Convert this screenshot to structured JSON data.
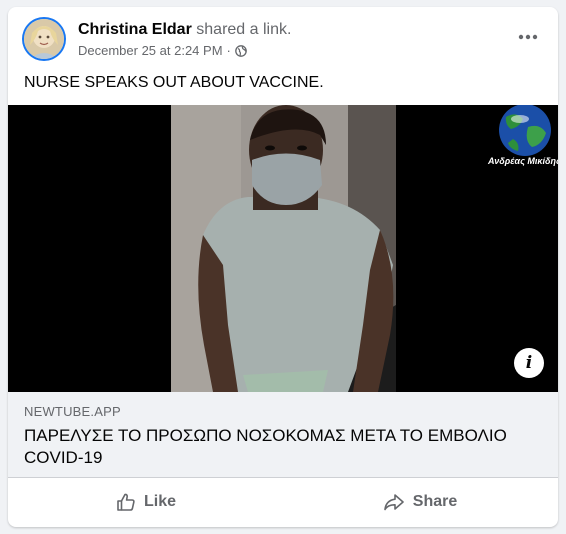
{
  "post": {
    "author": "Christina Eldar",
    "action_text": "shared a link.",
    "timestamp": "December 25 at 2:24 PM",
    "separator": "·",
    "privacy_icon": "globe-icon",
    "text": "NURSE SPEAKS OUT ABOUT VACCINE."
  },
  "media": {
    "watermark_text": "Ανδρέας Μικίδης"
  },
  "link_preview": {
    "domain": "NEWTUBE.APP",
    "title": "ΠΑΡΕΛΥΣΕ ΤΟ ΠΡΟΣΩΠΟ ΝΟΣΟΚΟΜΑΣ ΜΕΤΑ ΤΟ ΕΜΒΟΛΙΟ COVID-19"
  },
  "actions": {
    "like_label": "Like",
    "share_label": "Share"
  },
  "colors": {
    "accent": "#1877f2",
    "secondary_text": "#65676b",
    "link_box_bg": "#f0f2f5"
  }
}
